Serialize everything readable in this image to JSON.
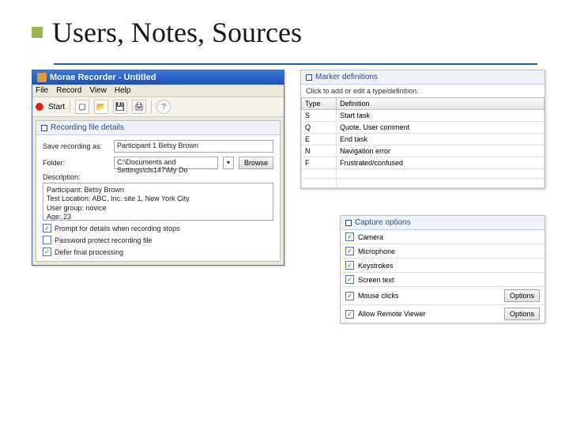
{
  "slide": {
    "title": "Users, Notes, Sources"
  },
  "recorder": {
    "title": "Morae Recorder - Untitled",
    "menu": [
      "File",
      "Record",
      "View",
      "Help"
    ],
    "start": "Start",
    "pane_title": "Recording file details",
    "save_label": "Save recording as:",
    "save_value": "Participant 1 Betsy Brown",
    "folder_label": "Folder:",
    "folder_value": "C:\\Documents and Settings\\cls147\\My Do",
    "browse": "Browse",
    "desc_label": "Description:",
    "desc_lines": [
      "Participant: Betsy Brown",
      "Test Location: ABC, Inc. site 1, New York City",
      "User group: novice",
      "Age: 23"
    ],
    "cb1": "Prompt for details when recording stops",
    "cb2": "Password protect recording file",
    "cb3": "Defer final processing"
  },
  "markers": {
    "pane_title": "Marker definitions",
    "hint": "Click to add or edit a type/definition.",
    "cols": [
      "Type",
      "Definition"
    ],
    "rows": [
      {
        "t": "S",
        "d": "Start task"
      },
      {
        "t": "Q",
        "d": "Quote, User comment"
      },
      {
        "t": "E",
        "d": "End task"
      },
      {
        "t": "N",
        "d": "Navigation error"
      },
      {
        "t": "F",
        "d": "Frustrated/confused"
      }
    ]
  },
  "capture": {
    "pane_title": "Capture options",
    "items": [
      {
        "label": "Camera",
        "checked": true,
        "btn": null
      },
      {
        "label": "Microphone",
        "checked": true,
        "btn": null
      },
      {
        "label": "Keystrokes",
        "checked": true,
        "btn": null
      },
      {
        "label": "Screen text",
        "checked": true,
        "btn": null
      },
      {
        "label": "Mouse clicks",
        "checked": true,
        "btn": "Options"
      },
      {
        "label": "Allow Remote Viewer",
        "checked": true,
        "btn": "Options"
      }
    ]
  }
}
